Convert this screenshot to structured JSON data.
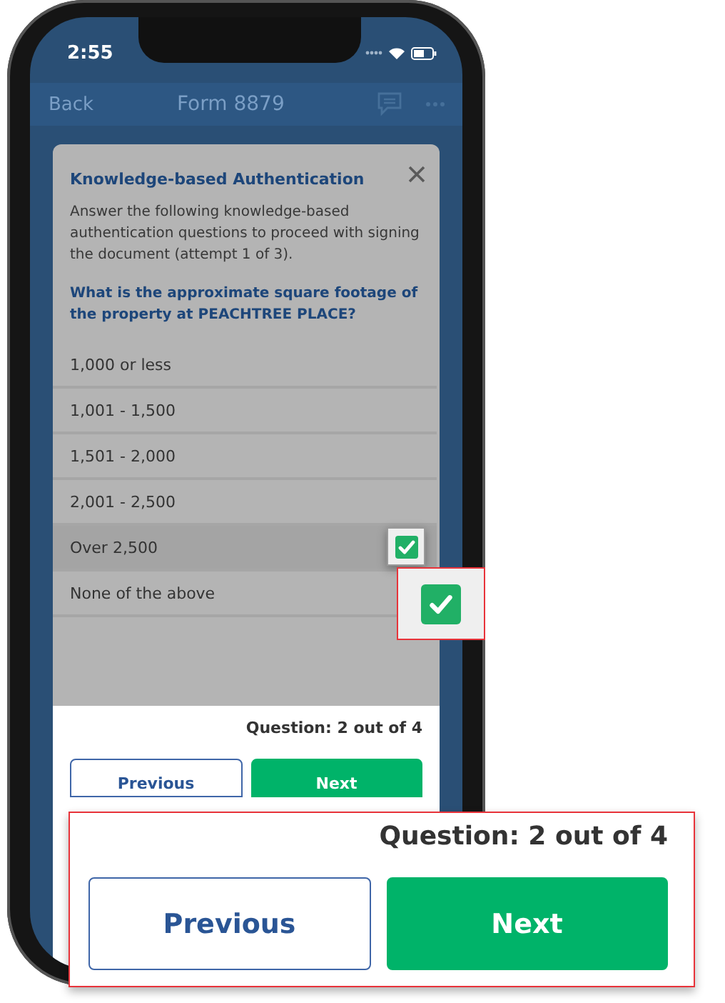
{
  "status_bar": {
    "time": "2:55"
  },
  "nav": {
    "back": "Back",
    "title": "Form 8879"
  },
  "modal": {
    "title": "Knowledge-based Authentication",
    "description": "Answer the following knowledge-based authentication questions to proceed with signing the document (attempt 1 of 3).",
    "question": "What is the approximate square footage of the property at PEACHTREE PLACE?",
    "options": [
      {
        "label": "1,000 or less",
        "selected": false
      },
      {
        "label": "1,001 - 1,500",
        "selected": false
      },
      {
        "label": "1,501 - 2,000",
        "selected": false
      },
      {
        "label": "2,001 - 2,500",
        "selected": false
      },
      {
        "label": "Over 2,500",
        "selected": true
      },
      {
        "label": "None of the above",
        "selected": false
      }
    ],
    "progress": "Question: 2 out of 4",
    "buttons": [
      {
        "label": "Previous",
        "kind": "secondary"
      },
      {
        "label": "Next",
        "kind": "primary"
      }
    ]
  },
  "callouts": {
    "checkbox": {
      "checked": true
    },
    "footer": {
      "progress": "Question: 2 out of 4",
      "buttons": [
        {
          "label": "Previous",
          "kind": "secondary"
        },
        {
          "label": "Next",
          "kind": "primary"
        }
      ]
    }
  }
}
